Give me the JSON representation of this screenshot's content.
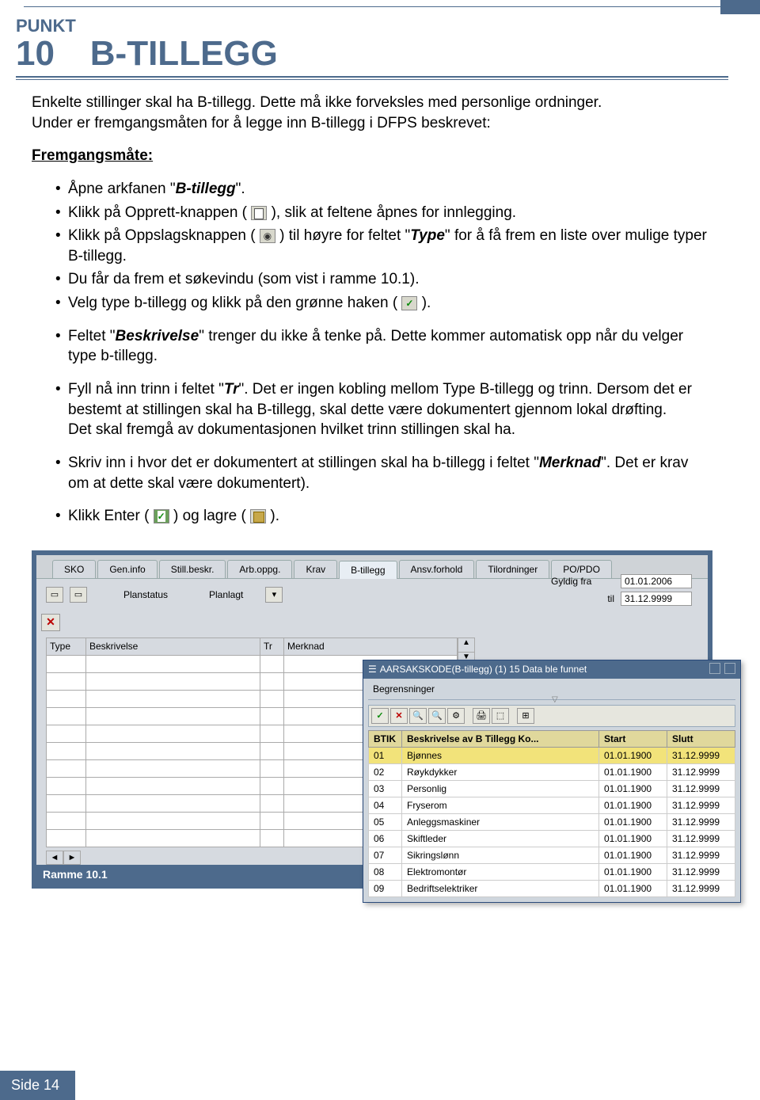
{
  "header": {
    "punkt_label": "PUNKT",
    "punkt_number": "10",
    "title": "B-TILLEGG"
  },
  "intro_line1": "Enkelte stillinger skal ha B-tillegg. Dette må ikke forveksles med personlige ordninger.",
  "intro_line2": "Under er fremgangsmåten for å legge inn B-tillegg i DFPS beskrevet:",
  "procedure_label": "Fremgangsmåte:",
  "bullets": {
    "b1_a": "Åpne arkfanen \"",
    "b1_b": "B-tillegg",
    "b1_c": "\".",
    "b2_a": "Klikk på Opprett-knappen (",
    "b2_b": "), slik at feltene åpnes for innlegging.",
    "b3_a": "Klikk på Oppslagsknappen (",
    "b3_b": ") til høyre for feltet \"",
    "b3_c": "Type",
    "b3_d": "\" for å få frem en liste over mulige typer B-tillegg.",
    "b4": "Du får da frem et søkevindu (som vist i ramme 10.1).",
    "b5_a": "Velg type b-tillegg og klikk på den grønne haken (",
    "b5_b": ").",
    "b6_a": "Feltet \"",
    "b6_b": "Beskrivelse",
    "b6_c": "\" trenger du ikke å tenke på. Dette kommer automatisk opp når du velger type b-tillegg.",
    "b7_a": "Fyll nå inn trinn i feltet \"",
    "b7_b": "Tr",
    "b7_c": "\". Det er ingen kobling mellom Type B-tillegg og trinn. Dersom det er bestemt at stillingen skal ha B-tillegg, skal dette være dokumentert gjennom lokal drøfting.",
    "b7_d": "Det skal fremgå av dokumentasjonen hvilket trinn stillingen skal ha.",
    "b8_a": "Skriv inn i hvor det er dokumentert at stillingen skal ha b-tillegg i feltet \"",
    "b8_b": "Merknad",
    "b8_c": "\". Det er krav om at dette skal være dokumentert).",
    "b9_a": "Klikk Enter (",
    "b9_b": ") og lagre (",
    "b9_c": ")."
  },
  "tabs": [
    "SKO",
    "Gen.info",
    "Still.beskr.",
    "Arb.oppg.",
    "Krav",
    "B-tillegg",
    "Ansv.forhold",
    "Tilordninger",
    "PO/PDO"
  ],
  "planstatus_label": "Planstatus",
  "planstatus_value": "Planlagt",
  "gyldig_fra_label": "Gyldig fra",
  "gyldig_fra_value": "01.01.2006",
  "til_label": "til",
  "til_value": "31.12.9999",
  "main_table_headers": [
    "Type",
    "Beskrivelse",
    "Tr",
    "Merknad"
  ],
  "popup": {
    "title": "AARSAKSKODE(B-tillegg) (1)   15 Data ble funnet",
    "restrictions": "Begrensninger",
    "cols": [
      "BTIK",
      "Beskrivelse av B Tillegg Ko...",
      "Start",
      "Slutt"
    ],
    "rows": [
      {
        "id": "01",
        "desc": "Bjønnes",
        "start": "01.01.1900",
        "end": "31.12.9999",
        "hl": true
      },
      {
        "id": "02",
        "desc": "Røykdykker",
        "start": "01.01.1900",
        "end": "31.12.9999"
      },
      {
        "id": "03",
        "desc": "Personlig",
        "start": "01.01.1900",
        "end": "31.12.9999"
      },
      {
        "id": "04",
        "desc": "Fryserom",
        "start": "01.01.1900",
        "end": "31.12.9999"
      },
      {
        "id": "05",
        "desc": "Anleggsmaskiner",
        "start": "01.01.1900",
        "end": "31.12.9999"
      },
      {
        "id": "06",
        "desc": "Skiftleder",
        "start": "01.01.1900",
        "end": "31.12.9999"
      },
      {
        "id": "07",
        "desc": "Sikringslønn",
        "start": "01.01.1900",
        "end": "31.12.9999"
      },
      {
        "id": "08",
        "desc": "Elektromontør",
        "start": "01.01.1900",
        "end": "31.12.9999"
      },
      {
        "id": "09",
        "desc": "Bedriftselektriker",
        "start": "01.01.1900",
        "end": "31.12.9999"
      }
    ]
  },
  "frame_caption": "Ramme 10.1",
  "footer": "Side 14"
}
